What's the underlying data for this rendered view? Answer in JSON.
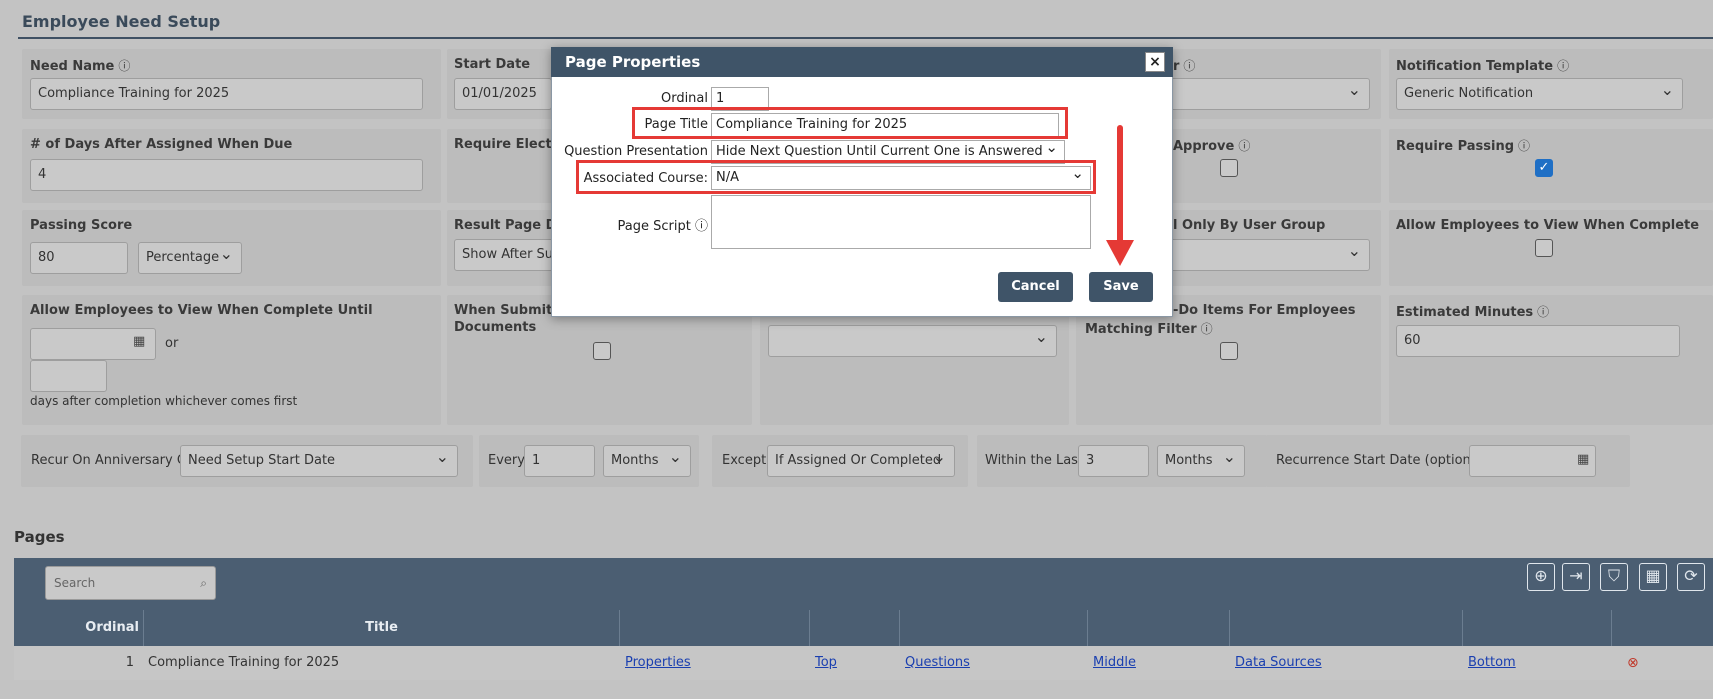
{
  "page": {
    "section_title": "Employee Need Setup",
    "info_glyph": "ⓘ",
    "calendar_glyph": "▦"
  },
  "fields": {
    "need_name": {
      "label": "Need Name",
      "value": "Compliance Training for 2025"
    },
    "start_date": {
      "label": "Start Date",
      "value": "01/01/2025"
    },
    "col3_label_tail": "r",
    "notification_template": {
      "label": "Notification Template",
      "value": "Generic Notification"
    },
    "days_due": {
      "label": "# of Days After Assigned When Due",
      "value": "4"
    },
    "require_electronic": {
      "label": "Require Electron"
    },
    "approve": {
      "label": "Approve"
    },
    "require_passing": {
      "label": "Require Passing"
    },
    "passing_score": {
      "label": "Passing Score",
      "value": "80",
      "type": "Percentage"
    },
    "result_page": {
      "label": "Result Page Disp",
      "value": "Show After Sub"
    },
    "user_group": {
      "label": "l Only By User Group"
    },
    "allow_view_complete": {
      "label": "Allow Employees to View When Complete"
    },
    "allow_view_until": {
      "label": "Allow Employees to View When Complete Until",
      "or": "or",
      "days_text": "days after completion whichever comes first"
    },
    "when_submitted": {
      "label_line1": "When Submitte",
      "label_line2": "Documents"
    },
    "todo_items": {
      "label_line1": "-Do Items For Employees",
      "label_line2": "Matching Filter"
    },
    "estimated_minutes": {
      "label": "Estimated Minutes",
      "value": "60"
    }
  },
  "recurrence": {
    "anniversary_label": "Recur On Anniversary Of",
    "anniversary_value": "Need Setup Start Date",
    "every_label": "Every",
    "every_value": "1",
    "every_unit": "Months",
    "except_label": "Except",
    "except_value": "If Assigned Or Completed",
    "within_label": "Within the Last",
    "within_value": "3",
    "within_unit": "Months",
    "start_label": "Recurrence Start Date (optional)"
  },
  "pages": {
    "title": "Pages",
    "search_placeholder": "Search",
    "search_icon": "⌕",
    "toolbar_icons": [
      "⊕",
      "⇥",
      "⛉",
      "▦",
      "⟳"
    ],
    "columns": {
      "ordinal": "Ordinal",
      "title": "Title"
    },
    "rows": [
      {
        "ordinal": "1",
        "title": "Compliance Training for 2025",
        "properties": "Properties",
        "top": "Top",
        "questions": "Questions",
        "middle": "Middle",
        "data_sources": "Data Sources",
        "bottom": "Bottom",
        "delete_icon": "⊗"
      }
    ]
  },
  "modal": {
    "title": "Page Properties",
    "close": "×",
    "ordinal_label": "Ordinal",
    "ordinal_value": "1",
    "page_title_label": "Page Title",
    "page_title_value": "Compliance Training for 2025",
    "question_presentation_label": "Question Presentation",
    "question_presentation_value": "Hide Next Question Until Current One is Answered",
    "associated_course_label": "Associated Course:",
    "associated_course_value": "N/A",
    "page_script_label": "Page Script",
    "cancel": "Cancel",
    "save": "Save"
  },
  "colors": {
    "header": "#3f5468",
    "highlight": "#e53935",
    "checkbox_on": "#1f6fc5"
  }
}
